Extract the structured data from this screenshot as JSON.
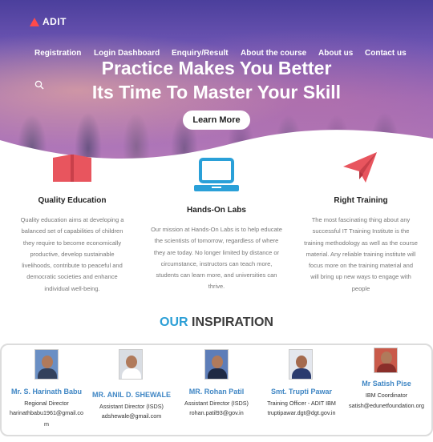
{
  "brand": {
    "name": "ADIT"
  },
  "nav": [
    {
      "label": "Registration"
    },
    {
      "label": "Login Dashboard"
    },
    {
      "label": "Enquiry/Result"
    },
    {
      "label": "About the course"
    },
    {
      "label": "About us"
    },
    {
      "label": "Contact us"
    }
  ],
  "hero": {
    "title_line1": "Practice Makes You Better",
    "title_line2": "Its Time To Master Your Skill",
    "button": "Learn More"
  },
  "features": [
    {
      "icon": "book-icon",
      "title": "Quality Education",
      "lines": [
        "Quality education aims at developing a",
        "balanced set of capabilities of children",
        "they require to become economically",
        "productive, develop sustainable",
        "livelihoods, contribute to peaceful and",
        "democratic societies and enhance",
        "individual well-being."
      ]
    },
    {
      "icon": "laptop-icon",
      "title": "Hands-On Labs",
      "lines": [
        "Our mission at Hands-On Labs is to help educate",
        "the scientists of tomorrow, regardless of where",
        "they are today. No longer limited by distance or",
        "circumstance, instructors can teach more,",
        "students can learn more, and universities can",
        "thrive."
      ]
    },
    {
      "icon": "paper-plane-icon",
      "title": "Right Training",
      "lines": [
        "The most fascinating thing about any",
        "successful IT Training Institute is the",
        "training methodology as well as the course",
        "material. Any reliable training institute will",
        "focus more on the training material and",
        "will bring up new ways to engage with",
        "people"
      ]
    }
  ],
  "inspiration": {
    "title_accent": "OUR",
    "title_rest": "INSPIRATION",
    "people": [
      {
        "name": "Mr. S. Harinath Babu",
        "role": "Regional Director",
        "email_lines": [
          "harinathbabu1961@gmail.co",
          "m"
        ]
      },
      {
        "name": "MR. ANIL D. SHEWALE",
        "role": "Assistant Director (ISDS)",
        "email_lines": [
          "adshewale@gmail.com"
        ]
      },
      {
        "name": "MR. Rohan Patil",
        "role": "Assistant Director (ISDS)",
        "email_lines": [
          "rohan.patil93@gov.in"
        ]
      },
      {
        "name": "Smt. Trupti Pawar",
        "role": "Training Officer - ADIT IBM",
        "email_lines": [
          "truptipawar.dgt@dgt.gov.in"
        ]
      },
      {
        "name": "Mr Satish Pise",
        "role": "IBM Coordinator",
        "email_lines": [
          "satish@edunetfoundation.org"
        ]
      }
    ]
  },
  "colors": {
    "accent": "#2c9fd6",
    "name_blue": "#3f86c4",
    "book_red": "#e8555e",
    "laptop_blue": "#2aa0d8",
    "plane_red": "#e8555e"
  }
}
